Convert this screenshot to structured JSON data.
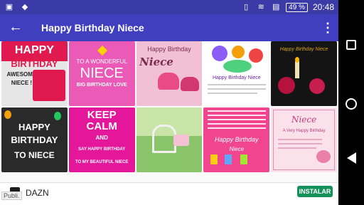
{
  "status_bar": {
    "left_icons": [
      "picture-icon",
      "dropbox-icon"
    ],
    "battery": "49 %",
    "time": "20:48"
  },
  "app_bar": {
    "title": "Happy Birthday Niece"
  },
  "grid": {
    "tiles": [
      {
        "id": "1",
        "texts": [
          "HAPPY",
          "BIRTHDAY",
          "AWESOME",
          "NIECE !"
        ],
        "bg": "#e6e6e6",
        "accent": "#e01a4f"
      },
      {
        "id": "2",
        "texts": [
          "TO A WONDERFUL",
          "NIECE",
          "BIG BIRTHDAY LOVE"
        ],
        "bg": "#ea5ab6",
        "accent": "#ffffff"
      },
      {
        "id": "3",
        "texts": [
          "Niece",
          "Happy Birthday"
        ],
        "bg": "#f2c0d4",
        "accent": "#7a2c4f"
      },
      {
        "id": "4",
        "texts": [
          "Happy Birthday Niece"
        ],
        "bg": "#ffffff",
        "accent": "#8b5cf6"
      },
      {
        "id": "5",
        "texts": [
          "Happy Birthday Niece"
        ],
        "bg": "#141414",
        "accent": "#d6a21a"
      },
      {
        "id": "6",
        "texts": [
          "HAPPY",
          "BIRTHDAY",
          "TO NIECE"
        ],
        "bg": "#2a2a2a",
        "accent": "#ffffff"
      },
      {
        "id": "7",
        "texts": [
          "KEEP",
          "CALM",
          "AND",
          "SAY HAPPY BIRTHDAY",
          "TO MY BEAUTIFUL NIECE"
        ],
        "bg": "#e4179b",
        "accent": "#ffffff"
      },
      {
        "id": "8",
        "texts": [],
        "bg": "#8ac46b",
        "accent": "#f5c1d4"
      },
      {
        "id": "9",
        "texts": [
          "Happy Birthday",
          "Niece"
        ],
        "bg": "#f2458f",
        "accent": "#ffffff"
      },
      {
        "id": "10",
        "texts": [
          "Niece",
          "A Very Happy Birthday"
        ],
        "bg": "#fbe2ea",
        "accent": "#c23c78"
      }
    ]
  },
  "ad": {
    "brand": "DAZN",
    "publi_label": "Publi.",
    "cta": "INSTALAR"
  },
  "colors": {
    "status_bar": "#3b3ba8",
    "app_bar": "#3f3fbf",
    "cta": "#14925a"
  }
}
